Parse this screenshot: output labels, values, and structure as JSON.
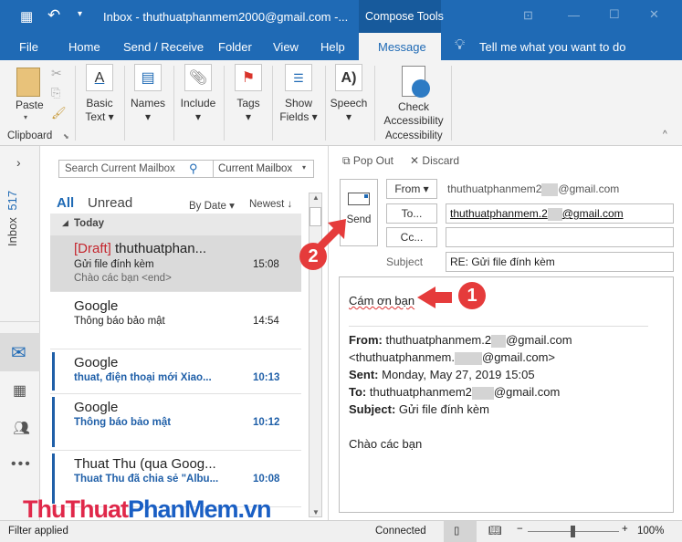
{
  "titlebar": {
    "title": "Inbox - thuthuatphanmem2000@gmail.com  -...",
    "context_tab": "Compose Tools"
  },
  "tabs": [
    "File",
    "Home",
    "Send / Receive",
    "Folder",
    "View",
    "Help",
    "Message"
  ],
  "active_tab": "Message",
  "tell_me": "Tell me what you want to do",
  "ribbon": {
    "paste": "Paste",
    "clipboard_group": "Clipboard",
    "basic_text_1": "Basic",
    "basic_text_2": "Text",
    "names": "Names",
    "include": "Include",
    "tags": "Tags",
    "show_fields_1": "Show",
    "show_fields_2": "Fields",
    "speech": "Speech",
    "check_1": "Check",
    "check_2": "Accessibility",
    "accessibility_group": "Accessibility"
  },
  "nav": {
    "inbox_label": "Inbox",
    "inbox_count": "517"
  },
  "search": {
    "placeholder": "Search Current Mailbox",
    "scope": "Current Mailbox"
  },
  "filters": {
    "all": "All",
    "unread": "Unread",
    "sort": "By Date",
    "order": "Newest"
  },
  "group_today": "Today",
  "messages": [
    {
      "tag": "[Draft]",
      "from": "thuthuatphan...",
      "subject": "Gửi file đính kèm",
      "preview": "Chào các bạn <end>",
      "time": "15:08"
    },
    {
      "from": "Google",
      "subject": "Thông báo bảo mật",
      "time": "14:54"
    },
    {
      "from": "Google",
      "subject": "thuat, điện thoại mới Xiao...",
      "time": "10:13"
    },
    {
      "from": "Google",
      "subject": "Thông báo bảo mật",
      "time": "10:12"
    },
    {
      "from": "Thuat Thu (qua Goog...",
      "subject": "Thuat Thu đã chia sẻ \"Albu...",
      "time": "10:08"
    }
  ],
  "compose": {
    "pop_out": "Pop Out",
    "discard": "Discard",
    "send": "Send",
    "from_btn": "From",
    "from_value_a": "thuthuatphanmem2",
    "from_value_b": "@gmail.com",
    "to_btn": "To...",
    "to_value_a": "thuthuatphanmem.2",
    "to_value_b": "@gmail.com",
    "cc_btn": "Cc...",
    "cc_value": "",
    "subject_label": "Subject",
    "subject_value": "RE: Gửi file đính kèm",
    "body_reply": "Cám ơn bạn",
    "hdr_from_label": "From:",
    "hdr_from_a": "thuthuatphanmem.2",
    "hdr_from_b": "@gmail.com",
    "hdr_from_line2_a": "<thuthuatphanmem.",
    "hdr_from_line2_b": "@gmail.com>",
    "hdr_sent_label": "Sent:",
    "hdr_sent": "Monday, May 27, 2019 15:05",
    "hdr_to_label": "To:",
    "hdr_to_a": "thuthuatphanmem2",
    "hdr_to_b": "@gmail.com",
    "hdr_subject_label": "Subject:",
    "hdr_subject": "Gửi file đính kèm",
    "body_text": "Chào các bạn"
  },
  "annotations": {
    "step1": "1",
    "step2": "2",
    "arrow_color": "#e53b3b"
  },
  "status": {
    "left": "Filter applied",
    "connected": "Connected",
    "zoom": "100%",
    "zoom_level_percent": 100
  },
  "watermark": {
    "part1": "ThuThuat",
    "part2": "PhanMem.vn"
  },
  "colors": {
    "accent": "#1f6ab5",
    "unread": "#1f5fa8",
    "draft": "#c4262e"
  }
}
